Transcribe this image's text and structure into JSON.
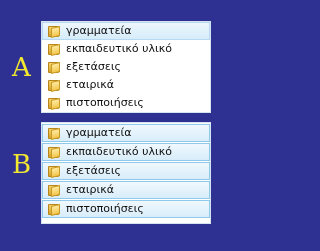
{
  "variants": [
    {
      "label": "A",
      "items": [
        {
          "label": "γραμματεία",
          "icon": "folder-icon"
        },
        {
          "label": "εκπαιδευτικό υλικό",
          "icon": "folder-icon"
        },
        {
          "label": "εξετάσεις",
          "icon": "folder-icon"
        },
        {
          "label": "εταιρικά",
          "icon": "folder-icon"
        },
        {
          "label": "πιστοποιήσεις",
          "icon": "folder-icon"
        }
      ]
    },
    {
      "label": "B",
      "items": [
        {
          "label": "γραμματεία",
          "icon": "folder-icon"
        },
        {
          "label": "εκπαιδευτικό υλικό",
          "icon": "folder-icon"
        },
        {
          "label": "εξετάσεις",
          "icon": "folder-icon"
        },
        {
          "label": "εταιρικά",
          "icon": "folder-icon"
        },
        {
          "label": "πιστοποιήσεις",
          "icon": "folder-icon"
        }
      ]
    }
  ],
  "colors": {
    "background": "#2e3192",
    "label": "#f2e830",
    "folder": "#f2c64d",
    "row_highlight_border": "#8fc9ec"
  }
}
